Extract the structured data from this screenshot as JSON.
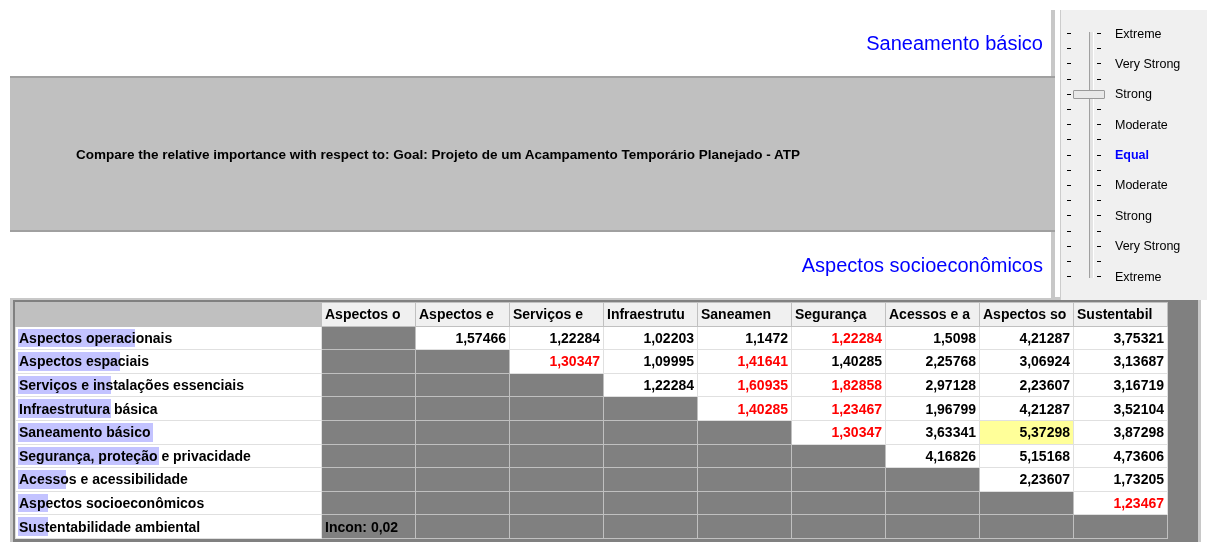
{
  "comparison": {
    "top_item": "Saneamento básico",
    "question": "Compare the relative importance with respect to: Goal: Projeto de um  Acampamento Temporário Planejado - ATP",
    "bottom_item": "Aspectos socioeconômicos"
  },
  "scale": {
    "level": 0.75,
    "labels": [
      {
        "text": "Extreme",
        "highlighted": false
      },
      {
        "text": "Very Strong",
        "highlighted": false
      },
      {
        "text": "Strong",
        "highlighted": false
      },
      {
        "text": "Moderate",
        "highlighted": false
      },
      {
        "text": "Equal",
        "highlighted": true
      },
      {
        "text": "Moderate",
        "highlighted": false
      },
      {
        "text": "Strong",
        "highlighted": false
      },
      {
        "text": "Very Strong",
        "highlighted": false
      },
      {
        "text": "Extreme",
        "highlighted": false
      }
    ]
  },
  "matrix": {
    "columns": [
      "Aspectos o",
      "Aspectos e",
      "Serviços e",
      "Infraestrutu",
      "Saneamen",
      "Segurança",
      "Acessos e a",
      "Aspectos so",
      "Sustentabil"
    ],
    "rows": [
      {
        "label": "Aspectos operacionais",
        "level": 0.39,
        "cells": [
          {
            "kind": "blank"
          },
          {
            "kind": "value",
            "text": "1,57466",
            "inverse": false,
            "selected": false
          },
          {
            "kind": "value",
            "text": "1,22284",
            "inverse": false,
            "selected": false
          },
          {
            "kind": "value",
            "text": "1,02203",
            "inverse": false,
            "selected": false
          },
          {
            "kind": "value",
            "text": "1,1472",
            "inverse": false,
            "selected": false
          },
          {
            "kind": "value",
            "text": "1,22284",
            "inverse": true,
            "selected": false
          },
          {
            "kind": "value",
            "text": "1,5098",
            "inverse": false,
            "selected": false
          },
          {
            "kind": "value",
            "text": "4,21287",
            "inverse": false,
            "selected": false
          },
          {
            "kind": "value",
            "text": "3,75321",
            "inverse": false,
            "selected": false
          }
        ]
      },
      {
        "label": "Aspectos espaciais",
        "level": 0.34,
        "cells": [
          {
            "kind": "blank"
          },
          {
            "kind": "blank"
          },
          {
            "kind": "value",
            "text": "1,30347",
            "inverse": true,
            "selected": false
          },
          {
            "kind": "value",
            "text": "1,09995",
            "inverse": false,
            "selected": false
          },
          {
            "kind": "value",
            "text": "1,41641",
            "inverse": true,
            "selected": false
          },
          {
            "kind": "value",
            "text": "1,40285",
            "inverse": false,
            "selected": false
          },
          {
            "kind": "value",
            "text": "2,25768",
            "inverse": false,
            "selected": false
          },
          {
            "kind": "value",
            "text": "3,06924",
            "inverse": false,
            "selected": false
          },
          {
            "kind": "value",
            "text": "3,13687",
            "inverse": false,
            "selected": false
          }
        ]
      },
      {
        "label": "Serviços e instalações essenciais",
        "level": 0.31,
        "cells": [
          {
            "kind": "blank"
          },
          {
            "kind": "blank"
          },
          {
            "kind": "blank"
          },
          {
            "kind": "value",
            "text": "1,22284",
            "inverse": false,
            "selected": false
          },
          {
            "kind": "value",
            "text": "1,60935",
            "inverse": true,
            "selected": false
          },
          {
            "kind": "value",
            "text": "1,82858",
            "inverse": true,
            "selected": false
          },
          {
            "kind": "value",
            "text": "2,97128",
            "inverse": false,
            "selected": false
          },
          {
            "kind": "value",
            "text": "2,23607",
            "inverse": false,
            "selected": false
          },
          {
            "kind": "value",
            "text": "3,16719",
            "inverse": false,
            "selected": false
          }
        ]
      },
      {
        "label": "Infraestrutura básica",
        "level": 0.31,
        "cells": [
          {
            "kind": "blank"
          },
          {
            "kind": "blank"
          },
          {
            "kind": "blank"
          },
          {
            "kind": "blank"
          },
          {
            "kind": "value",
            "text": "1,40285",
            "inverse": true,
            "selected": false
          },
          {
            "kind": "value",
            "text": "1,23467",
            "inverse": true,
            "selected": false
          },
          {
            "kind": "value",
            "text": "1,96799",
            "inverse": false,
            "selected": false
          },
          {
            "kind": "value",
            "text": "4,21287",
            "inverse": false,
            "selected": false
          },
          {
            "kind": "value",
            "text": "3,52104",
            "inverse": false,
            "selected": false
          }
        ]
      },
      {
        "label": "Saneamento básico",
        "level": 0.45,
        "cells": [
          {
            "kind": "blank"
          },
          {
            "kind": "blank"
          },
          {
            "kind": "blank"
          },
          {
            "kind": "blank"
          },
          {
            "kind": "blank"
          },
          {
            "kind": "value",
            "text": "1,30347",
            "inverse": true,
            "selected": false
          },
          {
            "kind": "value",
            "text": "3,63341",
            "inverse": false,
            "selected": false
          },
          {
            "kind": "value",
            "text": "5,37298",
            "inverse": false,
            "selected": true
          },
          {
            "kind": "value",
            "text": "3,87298",
            "inverse": false,
            "selected": false
          }
        ]
      },
      {
        "label": "Segurança, proteção e privacidade",
        "level": 0.47,
        "cells": [
          {
            "kind": "blank"
          },
          {
            "kind": "blank"
          },
          {
            "kind": "blank"
          },
          {
            "kind": "blank"
          },
          {
            "kind": "blank"
          },
          {
            "kind": "blank"
          },
          {
            "kind": "value",
            "text": "4,16826",
            "inverse": false,
            "selected": false
          },
          {
            "kind": "value",
            "text": "5,15168",
            "inverse": false,
            "selected": false
          },
          {
            "kind": "value",
            "text": "4,73606",
            "inverse": false,
            "selected": false
          }
        ]
      },
      {
        "label": "Acessos e acessibilidade",
        "level": 0.16,
        "cells": [
          {
            "kind": "blank"
          },
          {
            "kind": "blank"
          },
          {
            "kind": "blank"
          },
          {
            "kind": "blank"
          },
          {
            "kind": "blank"
          },
          {
            "kind": "blank"
          },
          {
            "kind": "blank"
          },
          {
            "kind": "value",
            "text": "2,23607",
            "inverse": false,
            "selected": false
          },
          {
            "kind": "value",
            "text": "1,73205",
            "inverse": false,
            "selected": false
          }
        ]
      },
      {
        "label": "Aspectos socioeconômicos",
        "level": 0.1,
        "cells": [
          {
            "kind": "blank"
          },
          {
            "kind": "blank"
          },
          {
            "kind": "blank"
          },
          {
            "kind": "blank"
          },
          {
            "kind": "blank"
          },
          {
            "kind": "blank"
          },
          {
            "kind": "blank"
          },
          {
            "kind": "blank"
          },
          {
            "kind": "value",
            "text": "1,23467",
            "inverse": true,
            "selected": false
          }
        ]
      },
      {
        "label": "Sustentabilidade ambiental",
        "level": 0.1,
        "cells": [
          {
            "kind": "note",
            "text": "Incon: 0,02"
          },
          {
            "kind": "blank"
          },
          {
            "kind": "blank"
          },
          {
            "kind": "blank"
          },
          {
            "kind": "blank"
          },
          {
            "kind": "blank"
          },
          {
            "kind": "blank"
          },
          {
            "kind": "blank"
          },
          {
            "kind": "blank"
          }
        ]
      }
    ]
  }
}
